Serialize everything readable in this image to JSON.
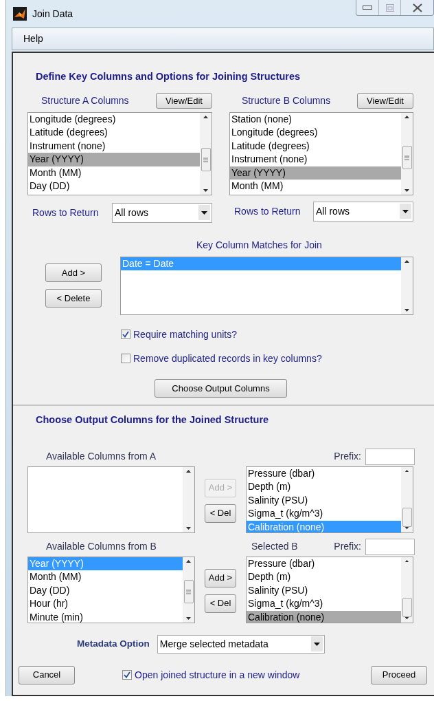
{
  "window": {
    "title": "Join Data"
  },
  "menu": [
    {
      "label": "Help"
    }
  ],
  "key_section": {
    "title": "Define Key Columns and Options for Joining Structures",
    "structures": [
      {
        "label": "Structure A Columns",
        "button": "View/Edit",
        "focused": false,
        "items": [
          {
            "text": "Longitude (degrees)",
            "selected": false
          },
          {
            "text": "Latitude (degrees)",
            "selected": false
          },
          {
            "text": "Instrument (none)",
            "selected": false
          },
          {
            "text": "Year (YYYY)",
            "selected": true
          },
          {
            "text": "Month (MM)",
            "selected": false
          },
          {
            "text": "Day (DD)",
            "selected": false
          }
        ],
        "rows_label": "Rows to Return",
        "rows_value": "All rows"
      },
      {
        "label": "Structure B Columns",
        "button": "View/Edit",
        "focused": false,
        "items": [
          {
            "text": "Station (none)",
            "selected": false
          },
          {
            "text": "Longitude (degrees)",
            "selected": false
          },
          {
            "text": "Latitude (degrees)",
            "selected": false
          },
          {
            "text": "Instrument (none)",
            "selected": false
          },
          {
            "text": "Year (YYYY)",
            "selected": true
          },
          {
            "text": "Month (MM)",
            "selected": false
          }
        ],
        "rows_label": "Rows to Return",
        "rows_value": "All rows"
      }
    ],
    "matches": {
      "label": "Key Column Matches for Join",
      "focused": true,
      "items": [
        {
          "text": "Date = Date",
          "selected": true
        }
      ]
    },
    "add_button": "Add >",
    "delete_button": "< Delete",
    "options": [
      {
        "label": "Require matching units?",
        "checked": true
      },
      {
        "label": "Remove duplicated records in key columns?",
        "checked": false
      }
    ],
    "choose_button": "Choose Output Columns"
  },
  "output_section": {
    "title": "Choose Output Columns for the Joined Structure",
    "groups": [
      {
        "available_label": "Available Columns from A",
        "focused_available": false,
        "selected_focused": true,
        "prefix_label": "Prefix:",
        "add_button": {
          "label": "Add >",
          "disabled": true
        },
        "del_button": {
          "label": "< Del",
          "disabled": false
        },
        "selected_items": [
          {
            "text": "Pressure (dbar)",
            "selected": false
          },
          {
            "text": "Depth (m)",
            "selected": false
          },
          {
            "text": "Salinity (PSU)",
            "selected": false
          },
          {
            "text": "Sigma_t (kg/m^3)",
            "selected": false
          },
          {
            "text": "Calibration (none)",
            "selected": true
          }
        ]
      },
      {
        "available_label": "Available Columns from B",
        "focused_available": true,
        "selected_focused": false,
        "selected_label": "Selected B",
        "prefix_label": "Prefix:",
        "add_button": {
          "label": "Add >",
          "disabled": false
        },
        "del_button": {
          "label": "< Del",
          "disabled": false
        },
        "available_items": [
          {
            "text": "Year (YYYY)",
            "selected": true
          },
          {
            "text": "Month (MM)",
            "selected": false
          },
          {
            "text": "Day (DD)",
            "selected": false
          },
          {
            "text": "Hour (hr)",
            "selected": false
          },
          {
            "text": "Minute (min)",
            "selected": false
          }
        ],
        "selected_items": [
          {
            "text": "Pressure (dbar)",
            "selected": false
          },
          {
            "text": "Depth (m)",
            "selected": false
          },
          {
            "text": "Salinity (PSU)",
            "selected": false
          },
          {
            "text": "Sigma_t (kg/m^3)",
            "selected": false
          },
          {
            "text": "Calibration (none)",
            "selected": true
          }
        ]
      }
    ],
    "metadata": {
      "label": "Metadata Option",
      "value": "Merge selected metadata"
    }
  },
  "footer": {
    "cancel": "Cancel",
    "open_option": {
      "label": "Open joined structure in a new window",
      "checked": true
    },
    "proceed": "Proceed"
  }
}
